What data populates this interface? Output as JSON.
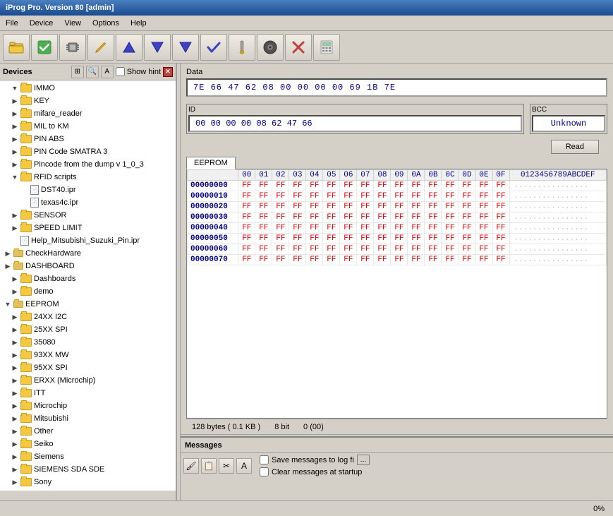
{
  "titleBar": {
    "text": "iProg Pro. Version 80 [admin]"
  },
  "menuBar": {
    "items": [
      "File",
      "Device",
      "View",
      "Options",
      "Help"
    ]
  },
  "toolbar": {
    "buttons": [
      {
        "name": "open-button",
        "icon": "📂"
      },
      {
        "name": "check-button",
        "icon": "✅"
      },
      {
        "name": "chip-button",
        "icon": "🔲"
      },
      {
        "name": "write-button",
        "icon": "💾"
      },
      {
        "name": "up-button",
        "icon": "▲"
      },
      {
        "name": "down-button",
        "icon": "▼"
      },
      {
        "name": "down2-button",
        "icon": "▼"
      },
      {
        "name": "ok-button",
        "icon": "✔"
      },
      {
        "name": "brush-button",
        "icon": "🖌"
      },
      {
        "name": "disk-button",
        "icon": "💿"
      },
      {
        "name": "cancel-button",
        "icon": "✖"
      },
      {
        "name": "calc-button",
        "icon": "🖩"
      }
    ]
  },
  "devicesPanel": {
    "label": "Devices",
    "showHint": "Show hint",
    "tree": [
      {
        "id": "immo",
        "label": "IMMO",
        "level": 1,
        "type": "folder",
        "expanded": true
      },
      {
        "id": "key",
        "label": "KEY",
        "level": 1,
        "type": "folder",
        "expanded": false
      },
      {
        "id": "mifare_reader",
        "label": "mifare_reader",
        "level": 1,
        "type": "folder",
        "expanded": false
      },
      {
        "id": "mil_to_km",
        "label": "MIL to KM",
        "level": 1,
        "type": "folder",
        "expanded": false
      },
      {
        "id": "pin_abs",
        "label": "PIN ABS",
        "level": 1,
        "type": "folder",
        "expanded": false
      },
      {
        "id": "pin_code_smatra3",
        "label": "PIN Code SMATRA 3",
        "level": 1,
        "type": "folder",
        "expanded": false
      },
      {
        "id": "pincode_from_dump",
        "label": "Pincode from the dump v 1_0_3",
        "level": 1,
        "type": "folder",
        "expanded": false
      },
      {
        "id": "rfid_scripts",
        "label": "RFID scripts",
        "level": 1,
        "type": "folder",
        "expanded": true
      },
      {
        "id": "dst40_ipr",
        "label": "DST40.ipr",
        "level": 2,
        "type": "file"
      },
      {
        "id": "texas4c_ipr",
        "label": "texas4c.ipr",
        "level": 2,
        "type": "file"
      },
      {
        "id": "sensor",
        "label": "SENSOR",
        "level": 1,
        "type": "folder",
        "expanded": false
      },
      {
        "id": "speed_limit",
        "label": "SPEED LIMIT",
        "level": 1,
        "type": "folder",
        "expanded": false
      },
      {
        "id": "help_mitsubishi",
        "label": "Help_Mitsubishi_Suzuki_Pin.ipr",
        "level": 1,
        "type": "file"
      },
      {
        "id": "check_hardware",
        "label": "CheckHardware",
        "level": 0,
        "type": "folder_special",
        "expanded": false
      },
      {
        "id": "dashboard",
        "label": "DASHBOARD",
        "level": 0,
        "type": "folder_special",
        "expanded": false
      },
      {
        "id": "dashboards",
        "label": "Dashboards",
        "level": 1,
        "type": "folder",
        "expanded": false
      },
      {
        "id": "demo",
        "label": "demo",
        "level": 1,
        "type": "folder",
        "expanded": false
      },
      {
        "id": "eeprom",
        "label": "EEPROM",
        "level": 0,
        "type": "folder_special",
        "expanded": true
      },
      {
        "id": "24xx_i2c",
        "label": "24XX I2C",
        "level": 1,
        "type": "folder",
        "expanded": false
      },
      {
        "id": "25xx_spi",
        "label": "25XX SPI",
        "level": 1,
        "type": "folder",
        "expanded": false
      },
      {
        "id": "35080",
        "label": "35080",
        "level": 1,
        "type": "folder",
        "expanded": false
      },
      {
        "id": "93xx_mw",
        "label": "93XX MW",
        "level": 1,
        "type": "folder",
        "expanded": false
      },
      {
        "id": "95xx_spi",
        "label": "95XX SPI",
        "level": 1,
        "type": "folder",
        "expanded": false
      },
      {
        "id": "erxx_microchip",
        "label": "ERXX (Microchip)",
        "level": 1,
        "type": "folder",
        "expanded": false
      },
      {
        "id": "itt",
        "label": "ITT",
        "level": 1,
        "type": "folder",
        "expanded": false
      },
      {
        "id": "microchip",
        "label": "Microchip",
        "level": 1,
        "type": "folder",
        "expanded": false
      },
      {
        "id": "mitsubishi",
        "label": "Mitsubishi",
        "level": 1,
        "type": "folder",
        "expanded": false
      },
      {
        "id": "other",
        "label": "Other",
        "level": 1,
        "type": "folder",
        "expanded": false
      },
      {
        "id": "seiko",
        "label": "Seiko",
        "level": 1,
        "type": "folder",
        "expanded": false
      },
      {
        "id": "siemens",
        "label": "Siemens",
        "level": 1,
        "type": "folder",
        "expanded": false
      },
      {
        "id": "siemens_sda_sde",
        "label": "SIEMENS SDA SDE",
        "level": 1,
        "type": "folder",
        "expanded": false
      },
      {
        "id": "sony",
        "label": "Sony",
        "level": 1,
        "type": "folder",
        "expanded": false
      }
    ]
  },
  "dataSection": {
    "label": "Data",
    "hexData": "7E  66  47  62  08  00  00  00  00  69  1B  7E"
  },
  "idSection": {
    "label": "ID",
    "value": "00  00  00  00  08  62  47  66"
  },
  "bccSection": {
    "label": "BCC",
    "value": "Unknown"
  },
  "readButton": {
    "label": "Read"
  },
  "eepromTab": {
    "label": "EEPROM",
    "columns": [
      "",
      "00",
      "01",
      "02",
      "03",
      "04",
      "05",
      "06",
      "07",
      "08",
      "09",
      "0A",
      "0B",
      "0C",
      "0D",
      "0E",
      "0F",
      "0123456789ABCDEF"
    ],
    "rows": [
      {
        "addr": "00000000",
        "vals": [
          "FF",
          "FF",
          "FF",
          "FF",
          "FF",
          "FF",
          "FF",
          "FF",
          "FF",
          "FF",
          "FF",
          "FF",
          "FF",
          "FF",
          "FF",
          "FF"
        ],
        "ascii": "................"
      },
      {
        "addr": "00000010",
        "vals": [
          "FF",
          "FF",
          "FF",
          "FF",
          "FF",
          "FF",
          "FF",
          "FF",
          "FF",
          "FF",
          "FF",
          "FF",
          "FF",
          "FF",
          "FF",
          "FF"
        ],
        "ascii": "................"
      },
      {
        "addr": "00000020",
        "vals": [
          "FF",
          "FF",
          "FF",
          "FF",
          "FF",
          "FF",
          "FF",
          "FF",
          "FF",
          "FF",
          "FF",
          "FF",
          "FF",
          "FF",
          "FF",
          "FF"
        ],
        "ascii": "................"
      },
      {
        "addr": "00000030",
        "vals": [
          "FF",
          "FF",
          "FF",
          "FF",
          "FF",
          "FF",
          "FF",
          "FF",
          "FF",
          "FF",
          "FF",
          "FF",
          "FF",
          "FF",
          "FF",
          "FF"
        ],
        "ascii": "................"
      },
      {
        "addr": "00000040",
        "vals": [
          "FF",
          "FF",
          "FF",
          "FF",
          "FF",
          "FF",
          "FF",
          "FF",
          "FF",
          "FF",
          "FF",
          "FF",
          "FF",
          "FF",
          "FF",
          "FF"
        ],
        "ascii": "................"
      },
      {
        "addr": "00000050",
        "vals": [
          "FF",
          "FF",
          "FF",
          "FF",
          "FF",
          "FF",
          "FF",
          "FF",
          "FF",
          "FF",
          "FF",
          "FF",
          "FF",
          "FF",
          "FF",
          "FF"
        ],
        "ascii": "................"
      },
      {
        "addr": "00000060",
        "vals": [
          "FF",
          "FF",
          "FF",
          "FF",
          "FF",
          "FF",
          "FF",
          "FF",
          "FF",
          "FF",
          "FF",
          "FF",
          "FF",
          "FF",
          "FF",
          "FF"
        ],
        "ascii": "................"
      },
      {
        "addr": "00000070",
        "vals": [
          "FF",
          "FF",
          "FF",
          "FF",
          "FF",
          "FF",
          "FF",
          "FF",
          "FF",
          "FF",
          "FF",
          "FF",
          "FF",
          "FF",
          "FF",
          "FF"
        ],
        "ascii": "................"
      }
    ],
    "statusBar": {
      "size": "128 bytes ( 0.1 KB )",
      "bits": "8 bit",
      "value": "0 (00)"
    }
  },
  "messagesSection": {
    "label": "Messages",
    "saveToLog": "Save messages to log fi",
    "clearAtStartup": "Clear messages at startup",
    "browseButton": "..."
  },
  "statusBar": {
    "progress": "0%"
  }
}
